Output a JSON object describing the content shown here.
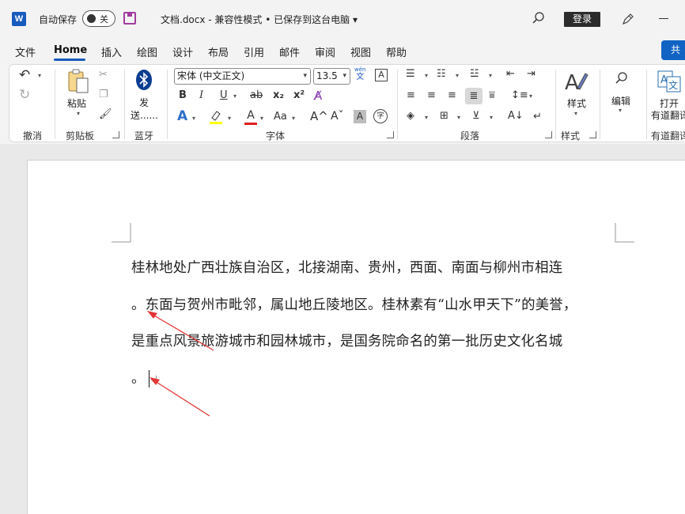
{
  "titlebar": {
    "app_icon": "W",
    "autosave_label": "自动保存",
    "autosave_state": "关",
    "doc_title": "文档.docx  -  兼容性模式 • 已保存到这台电脑  ▾",
    "login_label": "登录"
  },
  "tabs": [
    "文件",
    "Home",
    "插入",
    "绘图",
    "设计",
    "布局",
    "引用",
    "邮件",
    "审阅",
    "视图",
    "帮助"
  ],
  "share_label": "共",
  "ribbon": {
    "undo_group": "撤消",
    "clipboard": {
      "paste_label": "粘贴",
      "group": "剪贴板"
    },
    "bluetooth": {
      "send_label_1": "发",
      "send_label_2": "送......",
      "group": "蓝牙"
    },
    "font": {
      "font_name": "宋体 (中文正文)",
      "font_size": "13.5",
      "phonetic_top": "wén",
      "phonetic_bottom": "文",
      "bold": "B",
      "italic": "I",
      "underline": "U",
      "strike": "ab",
      "sub": "x₂",
      "sup": "x²",
      "text_effect": "A",
      "font_color": "A",
      "case": "Aa",
      "grow": "A^",
      "shrink": "Aˇ",
      "char_shade": "A",
      "enclose": "字",
      "group": "字体"
    },
    "paragraph_group": "段落",
    "styles": {
      "label": "样式",
      "group": "样式"
    },
    "editing": {
      "label": "编辑"
    },
    "youdao": {
      "label_1": "打开",
      "label_2": "有道翻译",
      "group": "有道翻译"
    }
  },
  "document": {
    "lines": [
      "桂林地处广西壮族自治区，北接湖南、贵州，西面、南面与柳州市相连",
      "。东面与贺州市毗邻，属山地丘陵地区。桂林素有“山水甲天下”的美誉，",
      "是重点风景旅游城市和园林城市，是国务院命名的第一批历史文化名城",
      "。"
    ],
    "paragraph_mark": "↵"
  },
  "colors": {
    "accent": "#185abd",
    "highlight": "#ffff00",
    "font_color": "#e02020",
    "annotation_arrow": "#e53535"
  }
}
